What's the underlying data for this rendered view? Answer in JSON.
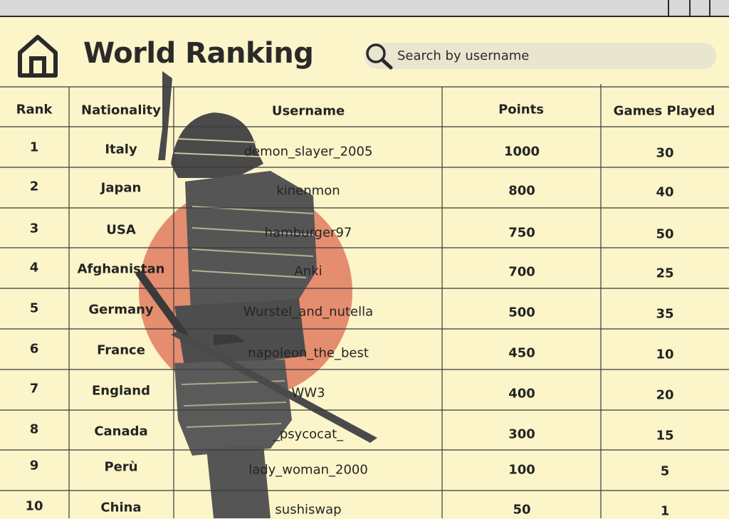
{
  "page": {
    "title": "World Ranking"
  },
  "search": {
    "placeholder": "Search by username"
  },
  "icons": {
    "home": "home-icon",
    "search": "search-icon"
  },
  "colors": {
    "background": "#fcf5c9",
    "sun": "#e07a5f",
    "samurai": "#4a4a4a"
  },
  "table": {
    "headers": [
      "Rank",
      "Nationality",
      "Username",
      "Points",
      "Games Played"
    ],
    "rows": [
      {
        "rank": "1",
        "nationality": "Italy",
        "username": "demon_slayer_2005",
        "points": "1000",
        "games": "30"
      },
      {
        "rank": "2",
        "nationality": "Japan",
        "username": "kinenmon",
        "points": "800",
        "games": "40"
      },
      {
        "rank": "3",
        "nationality": "USA",
        "username": "hamburger97",
        "points": "750",
        "games": "50"
      },
      {
        "rank": "4",
        "nationality": "Afghanistan",
        "username": "Anki",
        "points": "700",
        "games": "25"
      },
      {
        "rank": "5",
        "nationality": "Germany",
        "username": "Wurstel_and_nutella",
        "points": "500",
        "games": "35"
      },
      {
        "rank": "6",
        "nationality": "France",
        "username": "napoleon_the_best",
        "points": "450",
        "games": "10"
      },
      {
        "rank": "7",
        "nationality": "England",
        "username": "WW3",
        "points": "400",
        "games": "20"
      },
      {
        "rank": "8",
        "nationality": "Canada",
        "username": "_psycocat_",
        "points": "300",
        "games": "15"
      },
      {
        "rank": "9",
        "nationality": "Perù",
        "username": "lady_woman_2000",
        "points": "100",
        "games": "5"
      },
      {
        "rank": "10",
        "nationality": "China",
        "username": "sushiswap",
        "points": "50",
        "games": "1"
      }
    ]
  }
}
